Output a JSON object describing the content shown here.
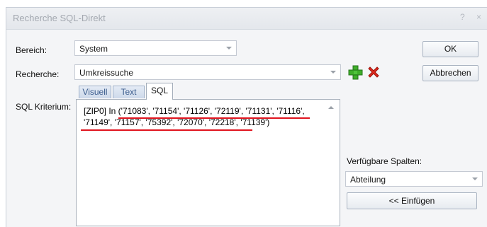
{
  "window": {
    "title": "Recherche SQL-Direkt",
    "help_glyph": "?",
    "close_glyph": "×"
  },
  "form": {
    "bereich_label": "Bereich:",
    "bereich_value": "System",
    "recherche_label": "Recherche:",
    "recherche_value": "Umkreissuche",
    "kriterium_label": "SQL Kriterium:"
  },
  "buttons": {
    "ok": "OK",
    "abbrechen": "Abbrechen",
    "einfuegen": "<< Einfügen"
  },
  "tabs": [
    {
      "label": "Visuell",
      "active": false
    },
    {
      "label": "Text",
      "active": false
    },
    {
      "label": "SQL",
      "active": true
    }
  ],
  "sql": {
    "line1": "[ZIP0] In ('71083', '71154', '71126', '72119', '71131', '71116',",
    "line2": "'71149', '71157', '75392', '72070', '72218', '71139')",
    "annotation_color": "#e0141e"
  },
  "columns": {
    "label": "Verfügbare Spalten:",
    "selected": "Abteilung"
  },
  "icons": {
    "add": "green-plus-icon",
    "delete": "red-x-icon"
  }
}
